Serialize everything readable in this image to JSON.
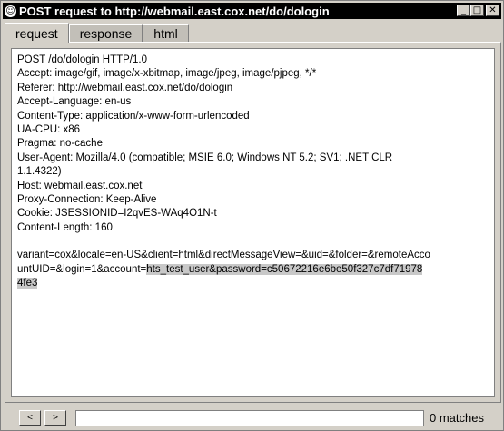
{
  "window": {
    "title": "POST request to http://webmail.east.cox.net/do/dologin",
    "icon": "browser-icon",
    "minimize": "minimize-icon",
    "maximize": "maximize-icon",
    "close": "close-icon"
  },
  "tabs": [
    {
      "label": "request",
      "active": true
    },
    {
      "label": "response",
      "active": false
    },
    {
      "label": "html",
      "active": false
    }
  ],
  "request": {
    "lines": [
      "POST /do/dologin HTTP/1.0",
      "Accept: image/gif, image/x-xbitmap, image/jpeg, image/pjpeg, */*",
      "Referer: http://webmail.east.cox.net/do/dologin",
      "Accept-Language: en-us",
      "Content-Type: application/x-www-form-urlencoded",
      "UA-CPU: x86",
      "Pragma: no-cache",
      "User-Agent: Mozilla/4.0 (compatible; MSIE 6.0; Windows NT 5.2; SV1; .NET CLR",
      "1.1.4322)",
      "Host: webmail.east.cox.net",
      "Proxy-Connection: Keep-Alive",
      "Cookie: JSESSIONID=I2qvES-WAq4O1N-t",
      "Content-Length: 160",
      "",
      "variant=cox&locale=en-US&client=html&directMessageView=&uid=&folder=&remoteAcco"
    ],
    "body_line2_plain": "untUID=&login=1&account=",
    "body_line2_selected": "hts_test_user&password=c50672216e6be50f327c7df71978",
    "body_line3_selected": "4fe3"
  },
  "search": {
    "prev_label": "<",
    "next_label": ">",
    "value": "",
    "matches_text": "0 matches"
  }
}
